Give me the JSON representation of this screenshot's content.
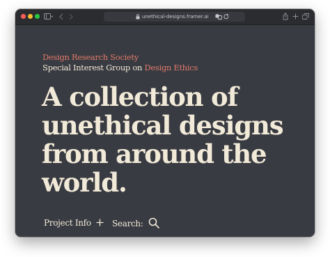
{
  "browser": {
    "url": "unethical-designs.framer.ai",
    "icons": [
      "sidebar-icon",
      "back-icon",
      "forward-icon",
      "lock-icon",
      "translate-icon",
      "reload-icon",
      "share-icon",
      "new-tab-icon",
      "tabs-icon"
    ]
  },
  "page": {
    "org_name": "Design Research Society",
    "group_prefix": "Special Interest Group on ",
    "group_highlight": "Design Ethics",
    "headline": "A collection of unethical designs from around the world.",
    "project_info_label": "Project Info",
    "search_label": "Search:"
  },
  "colors": {
    "background": "#393b42",
    "accent": "#e07a6a",
    "text": "#f2ead8"
  }
}
